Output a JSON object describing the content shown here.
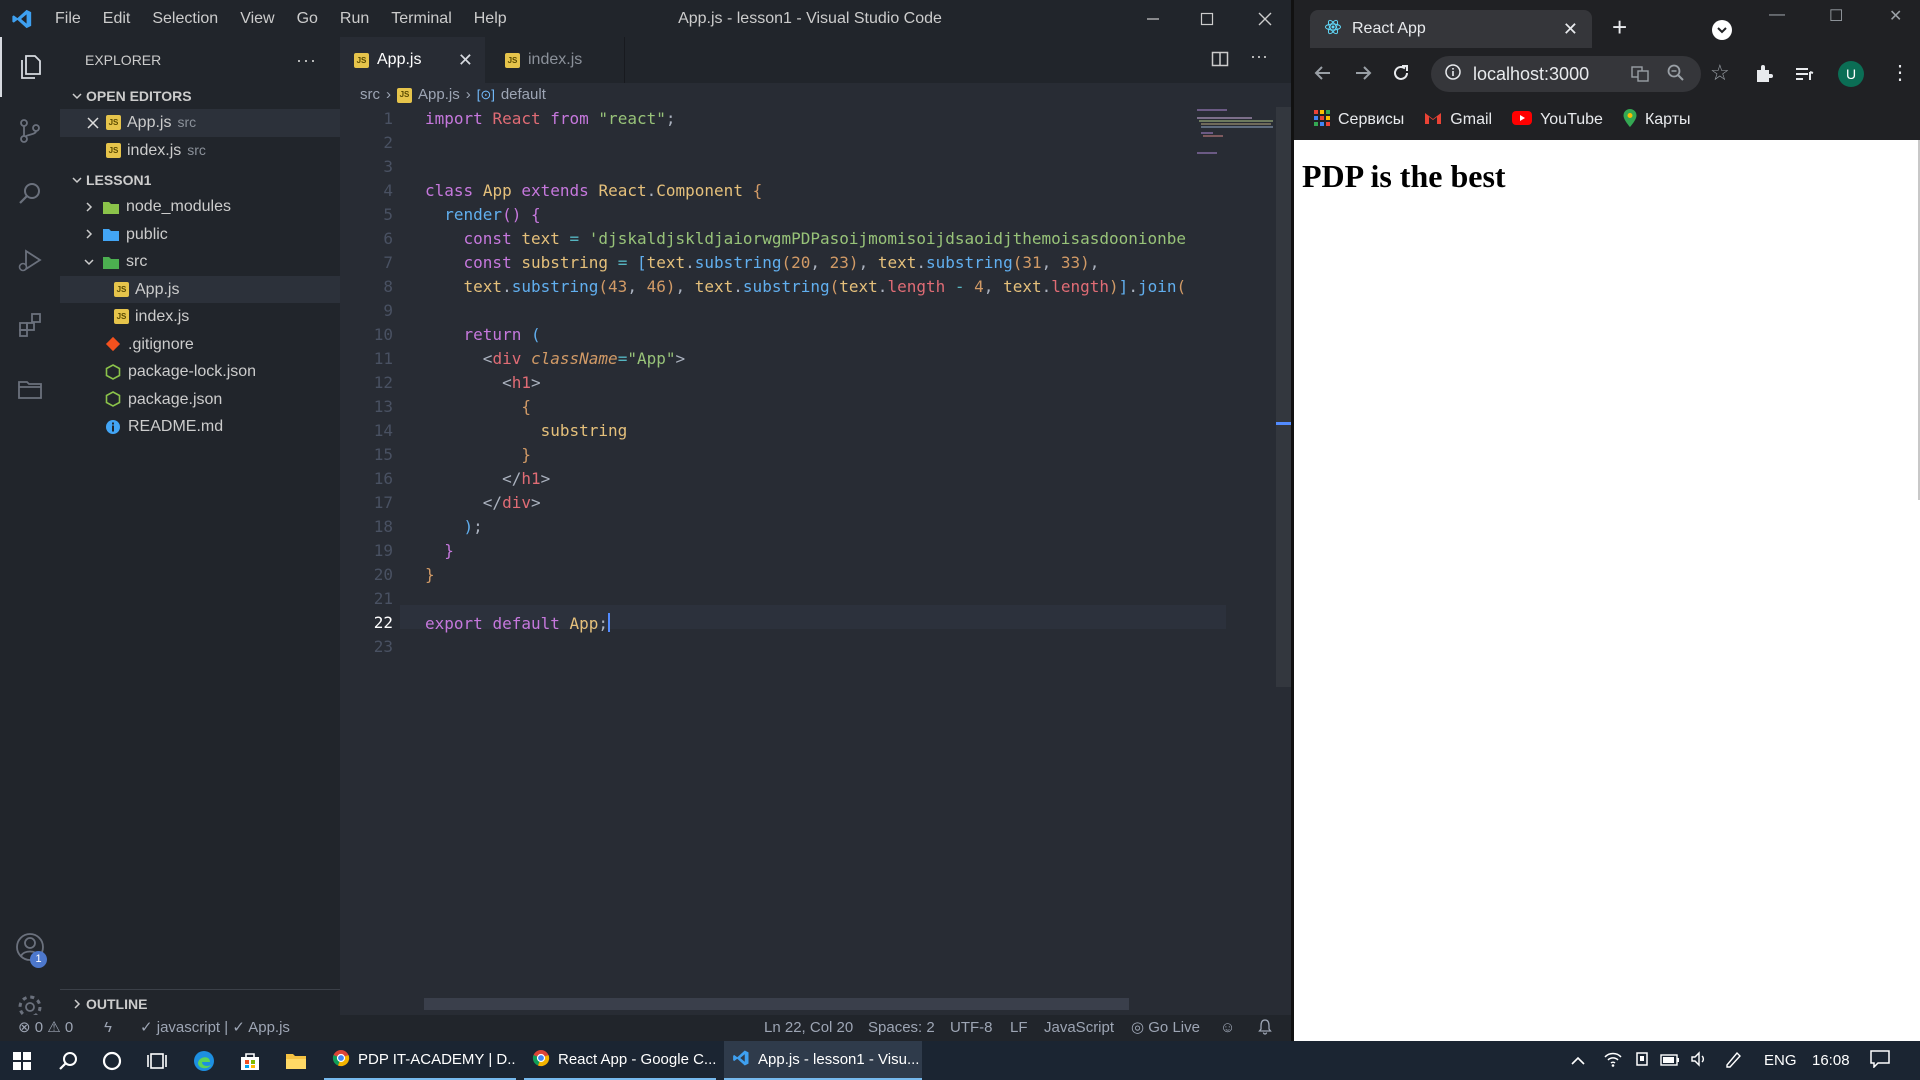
{
  "vscode": {
    "window_title": "App.js - lesson1 - Visual Studio Code",
    "menu": [
      "File",
      "Edit",
      "Selection",
      "View",
      "Go",
      "Run",
      "Terminal",
      "Help"
    ],
    "explorer": {
      "title": "EXPLORER",
      "open_editors_label": "OPEN EDITORS",
      "open_editors": [
        {
          "name": "App.js",
          "desc": "src"
        },
        {
          "name": "index.js",
          "desc": "src"
        }
      ],
      "project_label": "LESSON1",
      "tree": {
        "node_modules": "node_modules",
        "public": "public",
        "src": "src",
        "app_js": "App.js",
        "index_js": "index.js",
        "gitignore": ".gitignore",
        "package_lock": "package-lock.json",
        "package_json": "package.json",
        "readme": "README.md"
      },
      "outline_label": "OUTLINE"
    },
    "accounts_badge": "1",
    "tabs": [
      {
        "label": "App.js"
      },
      {
        "label": "index.js"
      }
    ],
    "breadcrumb": [
      "src",
      "App.js",
      "default"
    ],
    "line_numbers": [
      "1",
      "2",
      "3",
      "4",
      "5",
      "6",
      "7",
      "8",
      "9",
      "10",
      "11",
      "12",
      "13",
      "14",
      "15",
      "16",
      "17",
      "18",
      "19",
      "20",
      "21",
      "22",
      "23"
    ],
    "current_line": "22",
    "code": {
      "l1_kw": "import",
      "l1_name": "React",
      "l1_from": "from",
      "l1_str": "\"react\"",
      "l1_end": ";",
      "l4_class": "class",
      "l4_name": "App",
      "l4_extends": "extends",
      "l4_react": "React",
      "l4_comp": "Component",
      "l4_brace": "{",
      "l5_fn": "render",
      "l5_rest": "() {",
      "l6_const": "const",
      "l6_var": "text",
      "l6_eq": "=",
      "l6_str": "'djskaldjskldjaiorwgmPDPasoijmomisoijdsaoidjthemoisasdoonionbe",
      "l7_const": "const",
      "l7_var": "substring",
      "l7_eq": "=",
      "l8_tail": "text.length",
      "l10_ret": "return",
      "l11_tag": "div",
      "l11_attr": "className",
      "l11_val": "\"App\"",
      "l12_tag": "h1",
      "l14_var": "substring",
      "l16_tag": "h1",
      "l17_tag": "div",
      "l22_export": "export",
      "l22_default": "default",
      "l22_app": "App"
    },
    "status": {
      "errors": "0",
      "warnings": "0",
      "lint": "javascript | ✓ App.js",
      "position": "Ln 22, Col 20",
      "spaces": "Spaces: 2",
      "encoding": "UTF-8",
      "eol": "LF",
      "language": "JavaScript",
      "golive": "Go Live"
    }
  },
  "chrome": {
    "tab_title": "React App",
    "address": "localhost:3000",
    "bookmarks": [
      "Сервисы",
      "Gmail",
      "YouTube",
      "Карты"
    ],
    "profile_initial": "U",
    "page_heading": "PDP is the best"
  },
  "taskbar": {
    "apps": [
      "PDP IT-ACADEMY | D...",
      "React App - Google C...",
      "App.js - lesson1 - Visu..."
    ],
    "language": "ENG",
    "time": "16:08"
  },
  "colors": {
    "editor_bg": "#282c34",
    "sidebar_bg": "#21252b",
    "accent": "#528bff",
    "keyword": "#c678dd",
    "string": "#98c379",
    "type": "#e5c07b"
  }
}
